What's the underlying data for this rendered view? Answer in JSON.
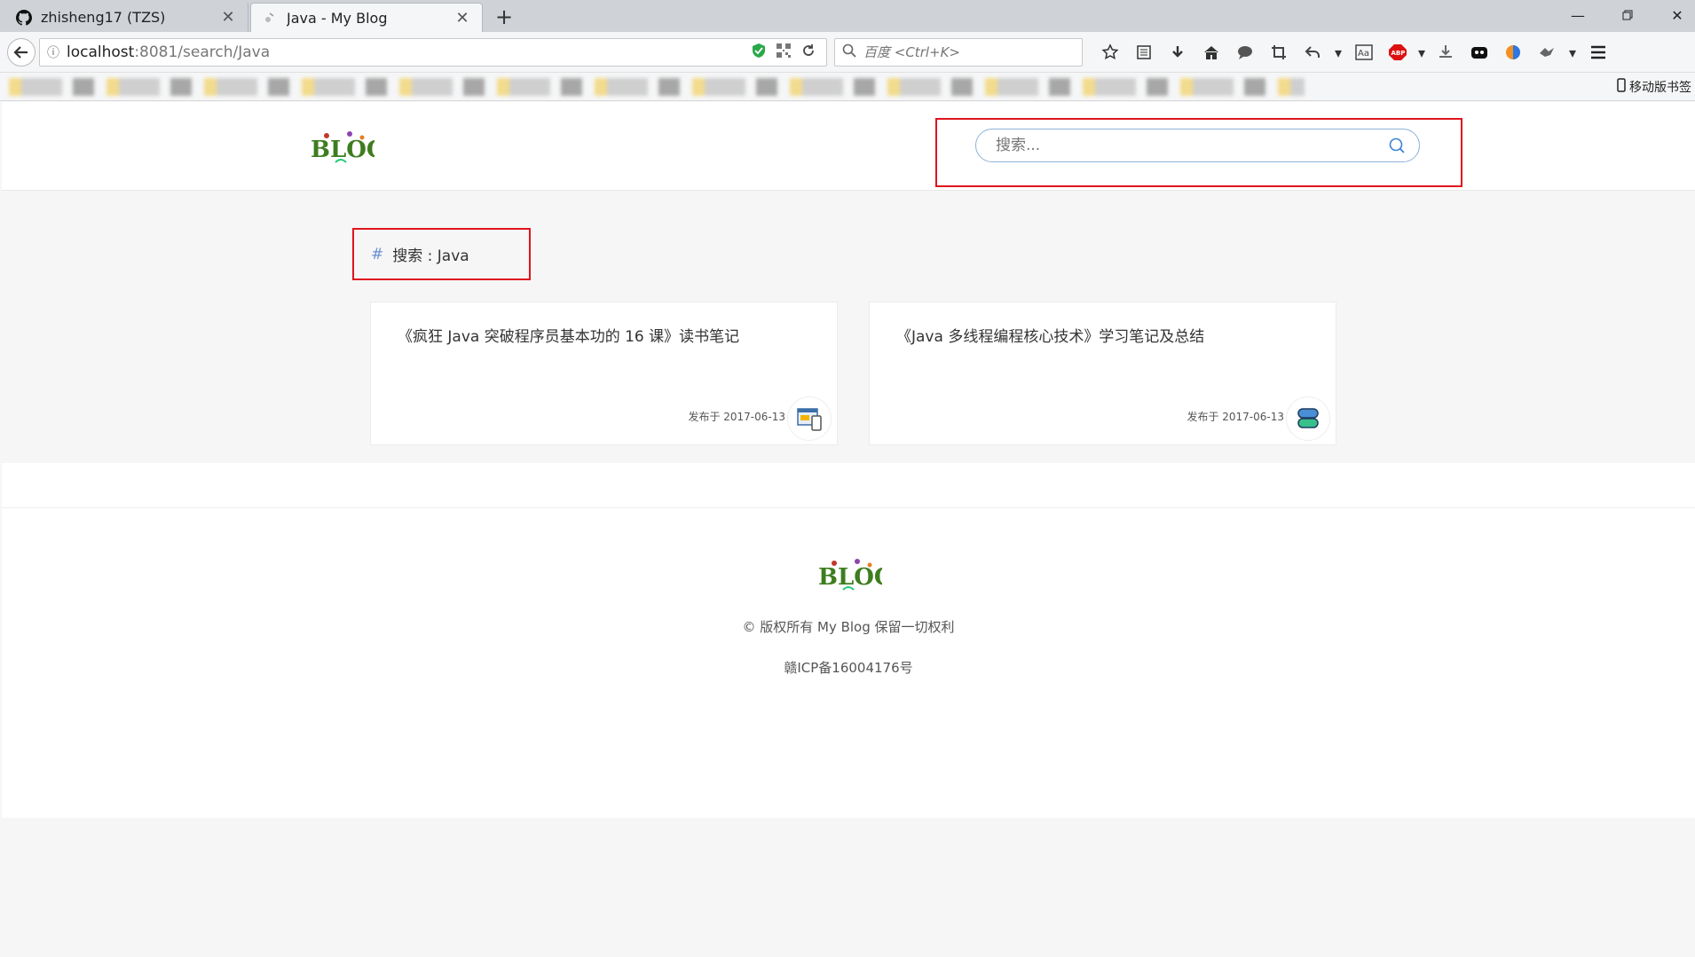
{
  "browser": {
    "tabs": [
      {
        "title": "zhisheng17 (TZS)",
        "active": false
      },
      {
        "title": "Java - My Blog",
        "active": true
      }
    ],
    "url": {
      "host": "localhost",
      "path": ":8081/search/Java"
    },
    "search_placeholder": "百度 <Ctrl+K>",
    "bookmarks_mobile_label": "移动版书签"
  },
  "header": {
    "logo_text": "BLOG",
    "search_placeholder": "搜索..."
  },
  "search_heading": {
    "hash": "#",
    "label": "搜索 : Java"
  },
  "posts": [
    {
      "title": "《疯狂 Java 突破程序员基本功的 16 课》读书笔记",
      "date": "发布于 2017-06-13"
    },
    {
      "title": "《Java 多线程编程核心技术》学习笔记及总结",
      "date": "发布于 2017-06-13"
    }
  ],
  "footer": {
    "logo_text": "BLOG",
    "copyright": "© 版权所有 My Blog 保留一切权利",
    "icp": "赣ICP备16004176号"
  },
  "colors": {
    "highlight_red": "#e0141e",
    "hash_blue": "#6a8fd0",
    "search_border": "#8fb2d9"
  }
}
